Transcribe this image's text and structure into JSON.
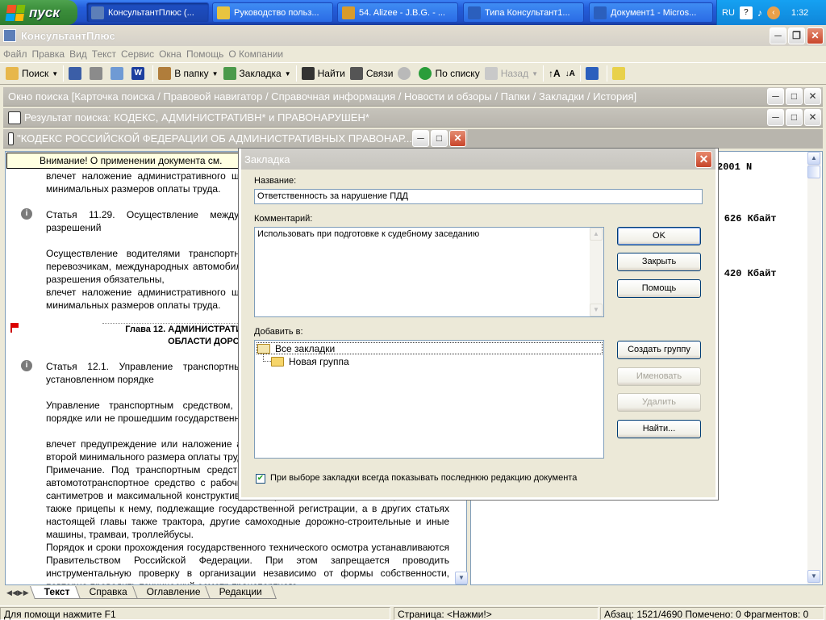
{
  "taskbar": {
    "start_label": "пуск",
    "tasks": [
      {
        "label": "КонсультантПлюс (...",
        "color": "#5d7fb8"
      },
      {
        "label": "Руководство польз...",
        "color": "#e8c440"
      },
      {
        "label": "54. Alizee - J.B.G. - ...",
        "color": "#d89b2b"
      },
      {
        "label": "Типа Консультант1...",
        "color": "#2b5fbd"
      },
      {
        "label": "Документ1 - Micros...",
        "color": "#2b5fbd"
      }
    ],
    "lang": "RU",
    "clock": "1:32"
  },
  "app": {
    "title": "КонсультантПлюс",
    "menu": [
      "Файл",
      "Правка",
      "Вид",
      "Текст",
      "Сервис",
      "Окна",
      "Помощь",
      "О Компании"
    ],
    "toolbar": {
      "search": "Поиск",
      "to_folder": "В папку",
      "bookmark": "Закладка",
      "find": "Найти",
      "links": "Связи",
      "by_list": "По списку",
      "back": "Назад"
    }
  },
  "panels": {
    "search_window": "Окно поиска [Карточка поиска / Правовой навигатор / Справочная информация / Новости и обзоры / Папки / Закладки / История]",
    "search_result": "Результат поиска: КОДЕКС, АДМИНИСТРАТИВН* и ПРАВОНАРУШЕН*",
    "document": "\"КОДЕКС РОССИЙСКОЙ ФЕДЕРАЦИИ ОБ АДМИНИСТРАТИВНЫХ ПРАВОНАР..."
  },
  "doc": {
    "warning": "Внимание! О применении документа см.",
    "paragraphs": [
      "        влечет наложение административного штрафа в размере от десяти до пятнадцати минимальных размеров оплаты труда.",
      "        Статья 11.29. Осуществление международных автомобильных перевозок без разрешений",
      "        Осуществление водителями транспортных средств, принадлежащих иностранным перевозчикам, международных автомобильных перевозок без разрешений, если такие разрешения обязательны,",
      "        влечет наложение административного штрафа в размере от десяти до пятнадцати минимальных размеров оплаты труда.",
      "Глава 12. АДМИНИСТРАТИВНЫЕ ПРАВОНАРУШЕНИЯ В ОБЛАСТИ ДОРОЖНОГО ДВИЖЕНИЯ",
      "        Статья 12.1. Управление транспортным средством, не зарегистрированным в установленном порядке",
      "        Управление транспортным средством, не зарегистрированным в установленном порядке или не прошедшим государственного технического осмотра, -",
      "        влечет предупреждение или наложение административного штрафа в размере одной второй минимального размера оплаты труда.",
      "        Примечание. Под транспортным средством в настоящей статье следует понимать автомототранспортное средство с рабочим объемом двигателя более 50 кубических сантиметров и максимальной конструктивной скоростью более 50 километров в час, а также прицепы к нему, подлежащие государственной регистрации, а в других статьях настоящей главы также трактора, другие самоходные дорожно-строительные и иные машины, трамваи, троллейбусы.",
      "        Порядок и сроки прохождения государственного технического осмотра устанавливаются Правительством Российской Федерации. При этом запрещается проводить инструментальную проверку в организации независимо от формы собственности, повторно проводить технический осмотр транспортного"
    ],
    "right_lines": [
      "2001 N",
      "и - 626 Кбайт",
      "у - 420 Кбайт"
    ],
    "tabs": [
      "Текст",
      "Справка",
      "Оглавление",
      "Редакции"
    ]
  },
  "dialog": {
    "title": "Закладка",
    "name_label": "Название:",
    "name_value": "Ответственность за нарушение ПДД",
    "comment_label": "Комментарий:",
    "comment_value": "Использовать при подготовке к судебному заседанию",
    "add_to_label": "Добавить в:",
    "tree": [
      "Все закладки",
      "Новая группа"
    ],
    "buttons": {
      "ok": "OK",
      "close": "Закрыть",
      "help": "Помощь",
      "create_group": "Создать группу",
      "rename": "Именовать",
      "delete": "Удалить",
      "find": "Найти..."
    },
    "checkbox_label": "При выборе закладки всегда показывать последнюю редакцию документа",
    "checkbox_checked": true
  },
  "status": {
    "help": "Для помощи нажмите F1",
    "page": "Страница: <Нажми!>",
    "position": "Абзац: 1521/4690  Помечено: 0  Фрагментов: 0"
  }
}
